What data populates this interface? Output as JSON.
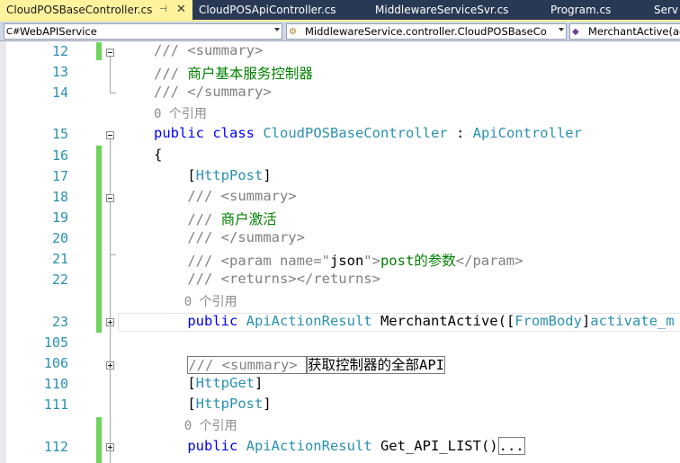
{
  "tabs": [
    {
      "label": "CloudPOSBaseController.cs",
      "active": true,
      "pin": "⊣",
      "close": "✕"
    },
    {
      "label": "CloudPOSApiController.cs"
    },
    {
      "label": "MiddlewareServiceSvr.cs"
    },
    {
      "label": "Program.cs"
    },
    {
      "label": "Serv"
    }
  ],
  "navbar": {
    "project": "WebAPIService",
    "type": "MiddlewareService.controller.CloudPOSBaseCo",
    "member": "MerchantActive(ac"
  },
  "lines": [
    {
      "num": "12",
      "tokens": [
        {
          "t": "/// <summary>",
          "c": "comment"
        }
      ]
    },
    {
      "num": "13",
      "tokens": [
        {
          "t": "/// ",
          "c": "comment"
        },
        {
          "t": "商户基本服务控制器",
          "c": "doc"
        }
      ]
    },
    {
      "num": "14",
      "tokens": [
        {
          "t": "/// </summary>",
          "c": "comment"
        }
      ]
    },
    {
      "num": "",
      "tokens": [
        {
          "t": "0 个引用",
          "c": "ref"
        }
      ]
    },
    {
      "num": "15",
      "tokens": [
        {
          "t": "public class ",
          "c": "kw"
        },
        {
          "t": "CloudPOSBaseController",
          "c": "type"
        },
        {
          "t": " : ",
          "c": "plain"
        },
        {
          "t": "ApiController",
          "c": "type"
        }
      ]
    },
    {
      "num": "16",
      "tokens": [
        {
          "t": "{",
          "c": "plain"
        }
      ]
    },
    {
      "num": "17",
      "tokens": [
        {
          "t": "    [",
          "c": "plain"
        },
        {
          "t": "HttpPost",
          "c": "type"
        },
        {
          "t": "]",
          "c": "plain"
        }
      ]
    },
    {
      "num": "18",
      "tokens": [
        {
          "t": "    /// <summary>",
          "c": "comment"
        }
      ]
    },
    {
      "num": "19",
      "tokens": [
        {
          "t": "    /// ",
          "c": "comment"
        },
        {
          "t": "商户激活",
          "c": "doc"
        }
      ]
    },
    {
      "num": "20",
      "tokens": [
        {
          "t": "    /// </summary>",
          "c": "comment"
        }
      ]
    },
    {
      "num": "21",
      "tokens": [
        {
          "t": "    /// <param name=\"",
          "c": "comment"
        },
        {
          "t": "json",
          "c": "plain"
        },
        {
          "t": "\">",
          "c": "comment"
        },
        {
          "t": "post的参数",
          "c": "doc"
        },
        {
          "t": "</param>",
          "c": "comment"
        }
      ]
    },
    {
      "num": "22",
      "tokens": [
        {
          "t": "    /// <returns></returns>",
          "c": "comment"
        }
      ]
    },
    {
      "num": "",
      "tokens": [
        {
          "t": "    0 个引用",
          "c": "ref"
        }
      ]
    },
    {
      "num": "23",
      "tokens": [
        {
          "t": "    public ",
          "c": "kw"
        },
        {
          "t": "ApiActionResult",
          "c": "type"
        },
        {
          "t": " MerchantActive([",
          "c": "plain"
        },
        {
          "t": "FromBody",
          "c": "type"
        },
        {
          "t": "]",
          "c": "plain"
        },
        {
          "t": "activate_m",
          "c": "type"
        }
      ]
    },
    {
      "num": "105",
      "tokens": []
    },
    {
      "num": "106",
      "tokens": [
        {
          "t": "    ",
          "c": "plain"
        },
        {
          "t": "/// <summary> ",
          "c": "comment",
          "box": true
        },
        {
          "t": "获取控制器的全部API",
          "c": "plain",
          "box": true
        }
      ]
    },
    {
      "num": "110",
      "tokens": [
        {
          "t": "    [",
          "c": "plain"
        },
        {
          "t": "HttpGet",
          "c": "type"
        },
        {
          "t": "]",
          "c": "plain"
        }
      ]
    },
    {
      "num": "111",
      "tokens": [
        {
          "t": "    [",
          "c": "plain"
        },
        {
          "t": "HttpPost",
          "c": "type"
        },
        {
          "t": "]",
          "c": "plain"
        }
      ]
    },
    {
      "num": "",
      "tokens": [
        {
          "t": "    0 个引用",
          "c": "ref"
        }
      ]
    },
    {
      "num": "112",
      "tokens": [
        {
          "t": "    public ",
          "c": "kw"
        },
        {
          "t": "ApiActionResult",
          "c": "type"
        },
        {
          "t": " Get_API_LIST()",
          "c": "plain"
        },
        {
          "t": "...",
          "c": "plain",
          "box": true
        }
      ]
    }
  ],
  "colors": {
    "tab_bar": "#293955",
    "active_tab": "#fff29d",
    "line_number": "#2b91af",
    "keyword": "#0000ff",
    "type": "#2b91af",
    "comment": "#808080",
    "doc_text": "#008000",
    "changed_margin": "#6cd45a"
  }
}
